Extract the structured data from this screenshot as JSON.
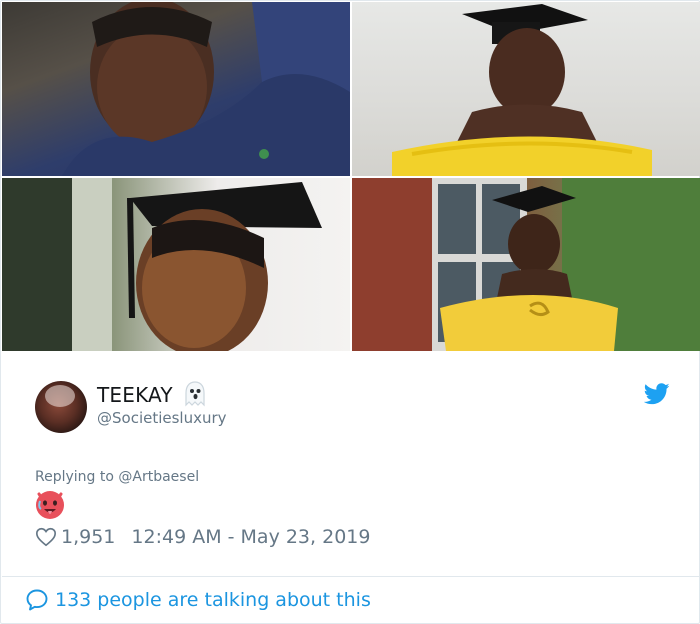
{
  "photos": [
    {
      "description_icon": "photo-selfie"
    },
    {
      "description_icon": "photo-graduation-yellow-dress"
    },
    {
      "description_icon": "photo-graduation-cap-closeup"
    },
    {
      "description_icon": "photo-graduation-outdoor"
    }
  ],
  "tweet": {
    "display_name": "TEEKAY",
    "name_emoji_icon": "ghost-icon",
    "handle": "@Societiesluxury",
    "reply_prefix": "Replying to ",
    "reply_to": "@Artbaesel",
    "body_emoji_icon": "hot-face-emoji-icon",
    "like_count": "1,951",
    "timestamp": "12:49 AM - May 23, 2019"
  },
  "footer": {
    "talking_text": "133 people are talking about this"
  },
  "colors": {
    "twitter_blue": "#1da1f2",
    "link_blue": "#1b95e0",
    "secondary_text": "#657786",
    "primary_text": "#14171a",
    "border": "#e1e8ed"
  }
}
